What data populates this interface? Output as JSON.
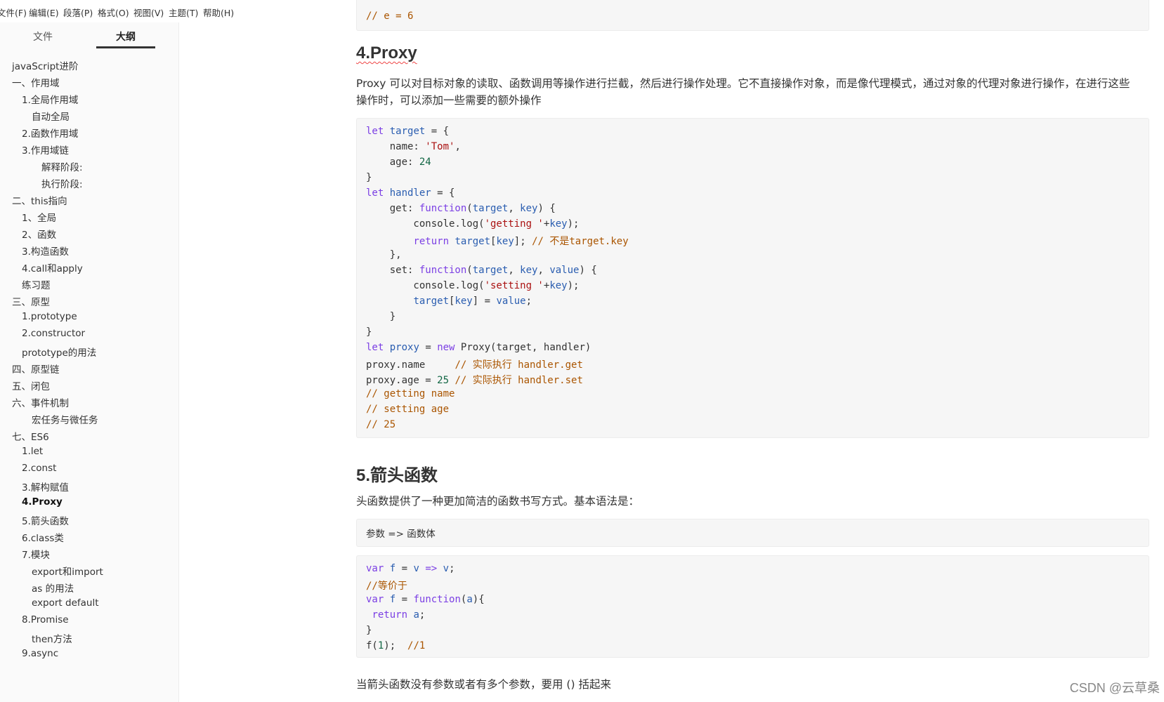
{
  "menu": [
    "文件(F)",
    "编辑(E)",
    "段落(P)",
    "格式(O)",
    "视图(V)",
    "主题(T)",
    "帮助(H)"
  ],
  "sidebar": {
    "tabs": [
      "文件",
      "大纲"
    ],
    "active_tab": "大纲",
    "items": [
      {
        "label": "javaScript进阶"
      },
      {
        "label": "一、作用域"
      },
      {
        "label": "1.全局作用域"
      },
      {
        "label": "自动全局"
      },
      {
        "label": "2.函数作用域"
      },
      {
        "label": "3.作用域链"
      },
      {
        "label": "解释阶段:"
      },
      {
        "label": "执行阶段:"
      },
      {
        "label": "二、this指向"
      },
      {
        "label": "1、全局"
      },
      {
        "label": "2、函数"
      },
      {
        "label": "3.构造函数"
      },
      {
        "label": "4.call和apply"
      },
      {
        "label": "练习题"
      },
      {
        "label": "三、原型"
      },
      {
        "label": "1.prototype"
      },
      {
        "label": "2.constructor"
      },
      {
        "label": "prototype的用法"
      },
      {
        "label": "四、原型链"
      },
      {
        "label": "五、闭包"
      },
      {
        "label": "六、事件机制"
      },
      {
        "label": "宏任务与微任务"
      },
      {
        "label": "七、ES6"
      },
      {
        "label": "1.let"
      },
      {
        "label": "2.const"
      },
      {
        "label": "3.解构赋值"
      },
      {
        "label": "4.Proxy"
      },
      {
        "label": "5.箭头函数"
      },
      {
        "label": "6.class类"
      },
      {
        "label": "7.模块"
      },
      {
        "label": "export和import"
      },
      {
        "label": "as 的用法"
      },
      {
        "label": "export default"
      },
      {
        "label": "8.Promise"
      },
      {
        "label": "then方法"
      },
      {
        "label": "9.async"
      }
    ]
  },
  "content": {
    "top_code_fragment": "// e = 6",
    "proxy_heading": "4.Proxy",
    "proxy_paragraph_1": "Proxy 可以对目标对象的读取、函数调用等操作进行拦截，然后进行操作处理。它不直接操作对象，而是像代理模式，通过对象的代理对象进行操作，在进行这些",
    "proxy_paragraph_2": "操作时，可以添加一些需要的额外操作",
    "proxy_code": [
      "let target = {",
      "    name: 'Tom',",
      "    age: 24",
      "}",
      "let handler = {",
      "    get: function(target, key) {",
      "        console.log('getting '+key);",
      "        return target[key]; // 不是target.key",
      "    },",
      "    set: function(target, key, value) {",
      "        console.log('setting '+key);",
      "        target[key] = value;",
      "    }",
      "}",
      "let proxy = new Proxy(target, handler)",
      "proxy.name     // 实际执行 handler.get",
      "proxy.age = 25 // 实际执行 handler.set",
      "// getting name",
      "// setting age",
      "// 25"
    ],
    "arrow_heading": "5.箭头函数",
    "arrow_paragraph": "头函数提供了一种更加简洁的函数书写方式。基本语法是：",
    "arrow_syntax": "参数 => 函数体",
    "arrow_code": [
      "var f = v => v;",
      "//等价于",
      "var f = function(a){",
      " return a;",
      "}",
      "f(1);  //1"
    ],
    "bottom_paragraph": "当箭头函数没有参数或者有多个参数，要用 () 括起来"
  },
  "watermark": "CSDN @云草桑",
  "colors": {
    "keyword": "#7b3fe4",
    "variable": "#2a5db0",
    "string": "#aa1111",
    "number": "#116644",
    "comment": "#aa5500"
  }
}
